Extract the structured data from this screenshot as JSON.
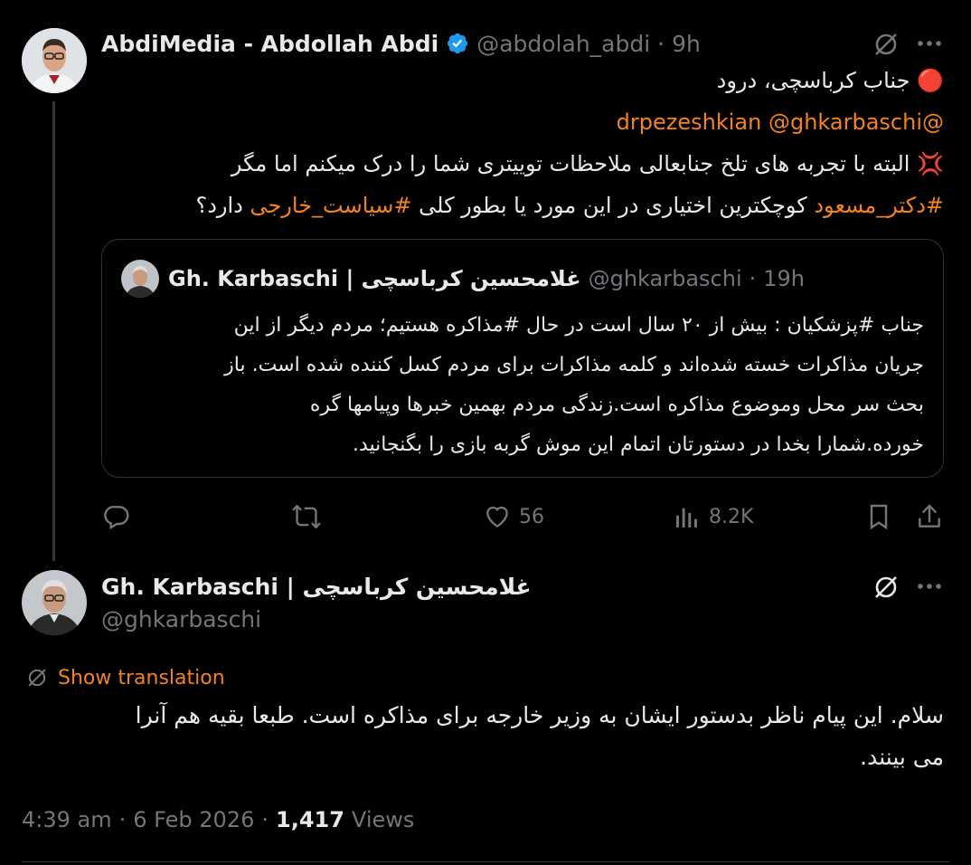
{
  "parent_tweet": {
    "author_name": "AbdiMedia - Abdollah Abdi",
    "handle": "@abdolah_abdi",
    "time_ago": "9h",
    "line1_emoji": "🔴",
    "line1": "جناب کرباسچی، درود",
    "mention1": "@drpezeshkian",
    "mention2": "@ghkarbaschi",
    "line3_emoji": "💢",
    "line3": "البته با تجربه های تلخ جنابعالی ملاحظات توییتری شما را درک میکنم اما مگر",
    "line4_hashtag1": "#دکتر_مسعود",
    "line4_mid": "کوچکترین اختیاری در این مورد یا بطور کلی",
    "line4_hashtag2": "#سیاست_خارجی",
    "line4_end": "دارد؟",
    "actions": {
      "likes": "56",
      "views": "8.2K"
    }
  },
  "quoted_tweet": {
    "author_name": "Gh. Karbaschi | غلامحسین کرباسچی",
    "handle": "@ghkarbaschi",
    "time_ago": "19h",
    "lines": [
      "جناب #پزشکیان : بیش از ۲۰ سال است در حال #مذاکره هستیم؛ مردم دیگر از این",
      "جریان مذاکرات خسته شده‌اند و کلمه مذاکرات برای مردم کسل کننده شده است. باز",
      "بحث سر محل وموضوع مذاکره است.زندگی مردم بهمین خبرها وپیامها گره",
      "خورده.شمارا بخدا در دستورتان اتمام این موش گربه بازی را بگنجانید."
    ]
  },
  "main_tweet": {
    "author_name": "Gh. Karbaschi | غلامحسین کرباسچی",
    "handle": "@ghkarbaschi",
    "show_translation": "Show translation",
    "lines": [
      "سلام. این پیام ناظر بدستور ایشان به وزیر خارجه برای مذاکره است. طبعا بقیه هم آنرا",
      "می بینند."
    ],
    "time": "4:39 am",
    "date": "6 Feb 2026",
    "views_count": "1,417",
    "views_label": "Views"
  },
  "colors": {
    "accent": "#f4821f",
    "muted": "#71767b",
    "verified": "#1d9bf0",
    "text": "#e7e9ea"
  }
}
